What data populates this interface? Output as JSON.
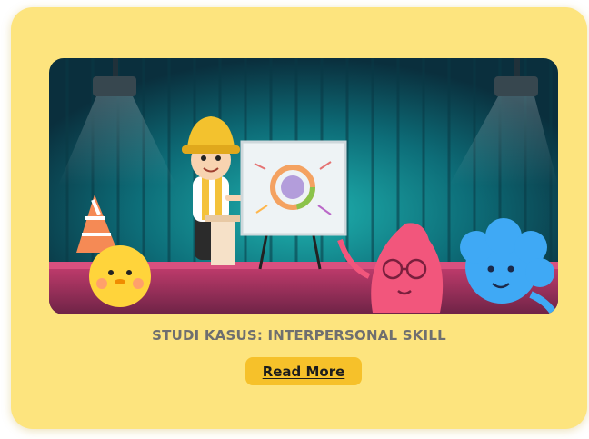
{
  "card": {
    "title": "STUDI KASUS: INTERPERSONAL SKILL",
    "button_label": "Read More",
    "illustration": {
      "description_icon": "presentation-stage-illustration",
      "colors": {
        "card_background": "#fde47e",
        "button_background": "#f6c12a",
        "title_text": "#6f6f6f",
        "stage_background": "#0b3b47",
        "stage_floor": "#8a2f55"
      }
    }
  }
}
